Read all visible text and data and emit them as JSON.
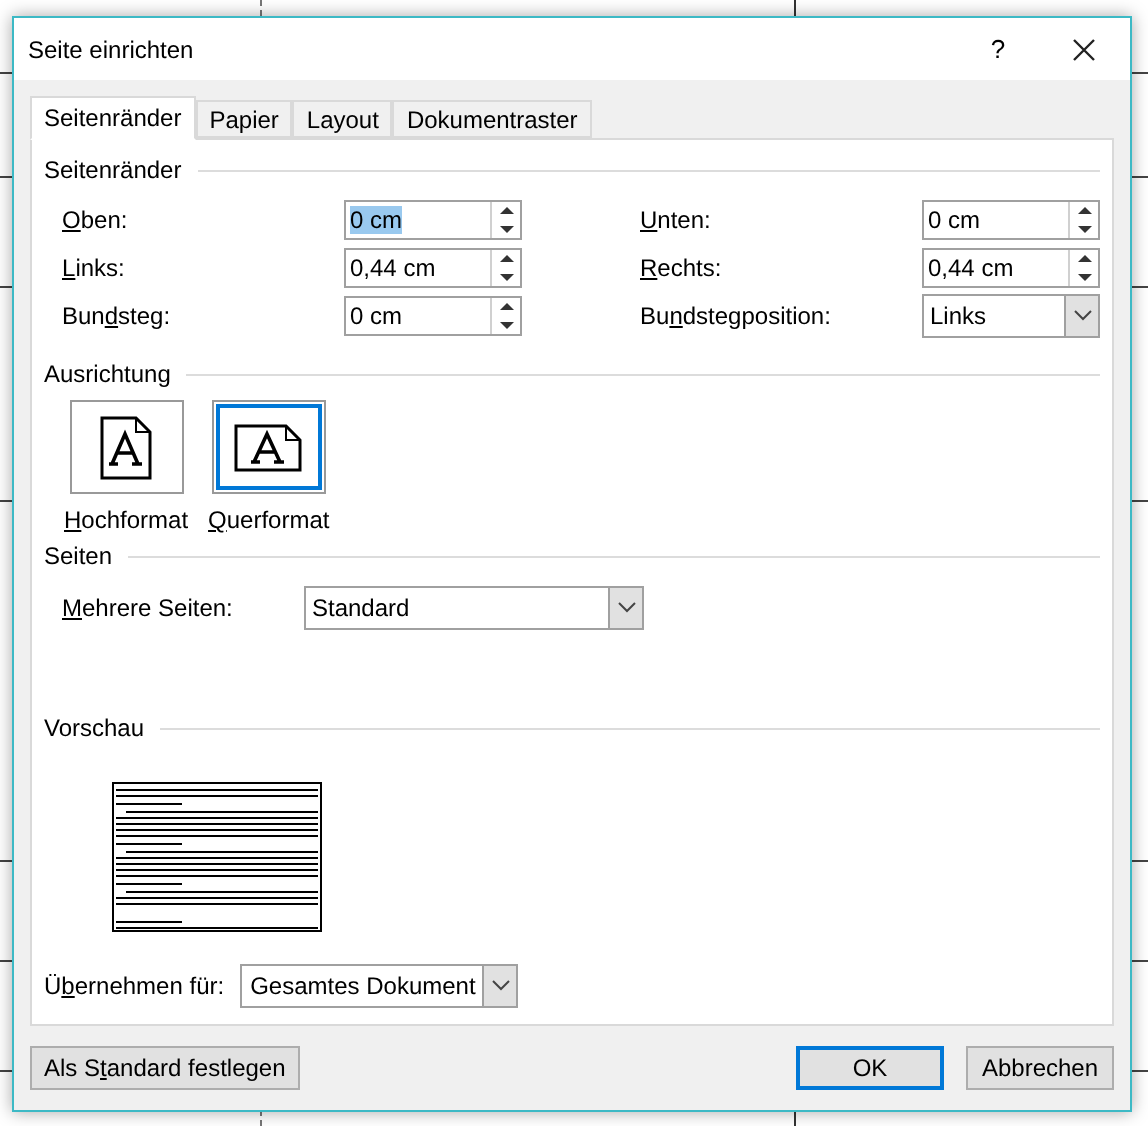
{
  "window": {
    "title": "Seite einrichten",
    "help": "?"
  },
  "tabs": [
    {
      "label": "Seitenränder",
      "selected": true
    },
    {
      "label": "Papier",
      "selected": false
    },
    {
      "label": "Layout",
      "selected": false
    },
    {
      "label": "Dokumentraster",
      "selected": false
    }
  ],
  "margins": {
    "title": "Seitenränder",
    "fields": [
      {
        "label": "Oben:",
        "value": "0 cm",
        "selected": true,
        "kind": "spin"
      },
      {
        "label": "Unten:",
        "value": "0 cm",
        "selected": false,
        "kind": "spin"
      },
      {
        "label": "Links:",
        "value": "0,44 cm",
        "selected": false,
        "kind": "spin"
      },
      {
        "label": "Rechts:",
        "value": "0,44 cm",
        "selected": false,
        "kind": "spin"
      },
      {
        "label": "Bundsteg:",
        "value": "0 cm",
        "selected": false,
        "kind": "spin"
      },
      {
        "label": "Bundstegposition:",
        "value": "Links",
        "selected": false,
        "kind": "dropdown"
      }
    ]
  },
  "orientation": {
    "title": "Ausrichtung",
    "options": [
      {
        "label": "Hochformat",
        "kind": "portrait",
        "selected": false
      },
      {
        "label": "Querformat",
        "kind": "landscape",
        "selected": true
      }
    ]
  },
  "pages": {
    "title": "Seiten",
    "label": "Mehrere Seiten:",
    "value": "Standard"
  },
  "preview": {
    "title": "Vorschau"
  },
  "apply": {
    "label": "Übernehmen für:",
    "value": "Gesamtes Dokument"
  },
  "buttons": [
    {
      "label": "Als Standard festlegen",
      "kind": "secondary",
      "default": false
    },
    {
      "label": "OK",
      "kind": "primary",
      "default": true
    },
    {
      "label": "Abbrechen",
      "kind": "primary",
      "default": false
    }
  ]
}
